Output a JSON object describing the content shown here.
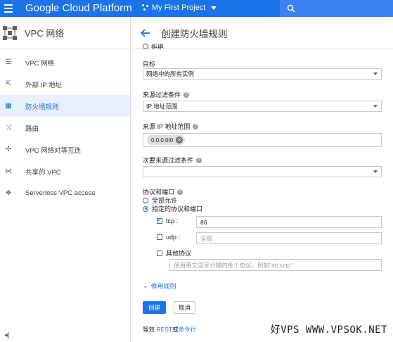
{
  "topbar": {
    "brand": "Google Cloud Platform",
    "project": "My First Project"
  },
  "sidebar": {
    "title": "VPC 网络",
    "items": [
      {
        "label": "VPC 网络",
        "icon": "network-icon"
      },
      {
        "label": "外部 IP 地址",
        "icon": "external-ip-icon"
      },
      {
        "label": "防火墙规则",
        "icon": "firewall-icon",
        "active": true
      },
      {
        "label": "路由",
        "icon": "routes-icon"
      },
      {
        "label": "VPC 网络对等互连",
        "icon": "peering-icon"
      },
      {
        "label": "共享的 VPC",
        "icon": "shared-vpc-icon"
      },
      {
        "label": "Serverless VPC access",
        "icon": "serverless-icon"
      }
    ],
    "collapse": "◂|"
  },
  "main": {
    "title": "创建防火墙规则",
    "cut_off_text": "拒绝",
    "target": {
      "label": "目标",
      "value": "网络中的所有实例"
    },
    "source_filter": {
      "label": "来源过滤条件",
      "value": "IP 地址范围"
    },
    "source_ip": {
      "label": "来源 IP 地址范围",
      "chip": "0.0.0.0/0"
    },
    "secondary_filter": {
      "label": "次要来源过滤条件",
      "value": ""
    },
    "protocols": {
      "label": "协议和端口",
      "allow_all": "全部允许",
      "specified": "指定的协议和端口",
      "tcp_label": "tcp :",
      "tcp_value": "80",
      "udp_label": "udp :",
      "udp_placeholder": "全部",
      "other_label": "其他协议",
      "other_placeholder": "使用英文逗号分隔的各个协议，例如\"ah,sctp\""
    },
    "disable_rule": "停用规则",
    "create_button": "创建",
    "cancel_button": "取消",
    "footer_prefix": "等效",
    "footer_rest": "REST",
    "footer_or": "或",
    "footer_cmd": "命令行"
  },
  "watermark": "好VPS WWW.VPSOK.NET"
}
